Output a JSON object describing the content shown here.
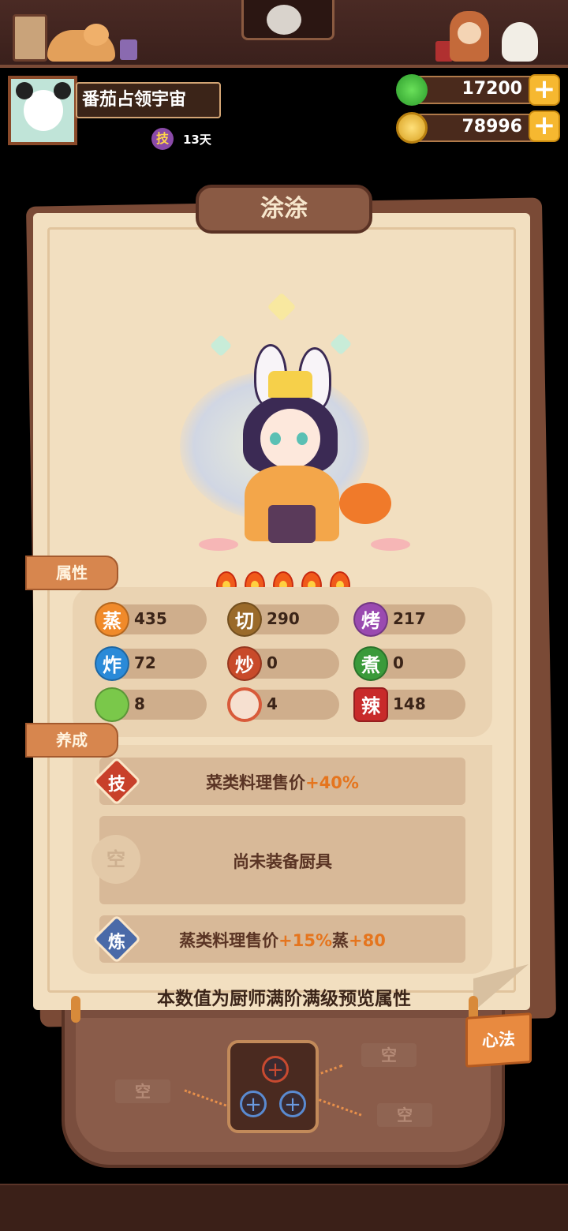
{
  "player": {
    "name": "番茄占领宇宙",
    "skill_badge": "技",
    "skill_days": "13天"
  },
  "currency": {
    "jade": "17200",
    "coins": "78996",
    "plus_label": "+"
  },
  "chef": {
    "name": "涂涂",
    "flames": 5
  },
  "sections": {
    "attributes": "属性",
    "cultivation": "养成"
  },
  "stats": [
    {
      "icon": "蒸",
      "value": "435",
      "color": "#f08a2a"
    },
    {
      "icon": "切",
      "value": "290",
      "color": "#9a6a2a"
    },
    {
      "icon": "烤",
      "value": "217",
      "color": "#9a4ab0"
    },
    {
      "icon": "炸",
      "value": "72",
      "color": "#2a8ad8"
    },
    {
      "icon": "炒",
      "value": "0",
      "color": "#c84a2a"
    },
    {
      "icon": "煮",
      "value": "0",
      "color": "#3a9a3a"
    },
    {
      "icon": "",
      "value": "8",
      "color": "#7ac84a"
    },
    {
      "icon": "",
      "value": "4",
      "color": "#d85a3a"
    },
    {
      "icon": "辣",
      "value": "148",
      "color": "#c82a2a"
    }
  ],
  "cultivation": {
    "skill": {
      "icon": "技",
      "text": "菜类料理售价",
      "bonus": "+40%"
    },
    "equipment": {
      "icon": "空",
      "text": "尚未装备厨具"
    },
    "refine": {
      "icon": "炼",
      "text1": "蒸类料理售价",
      "bonus1": "+15%",
      "text2": "蒸",
      "bonus2": "+80"
    }
  },
  "footer_note": "本数值为厨师满阶满级预览属性",
  "xinfa": {
    "tab_label": "心法",
    "empty_label": "空",
    "slot_plus": "+"
  }
}
